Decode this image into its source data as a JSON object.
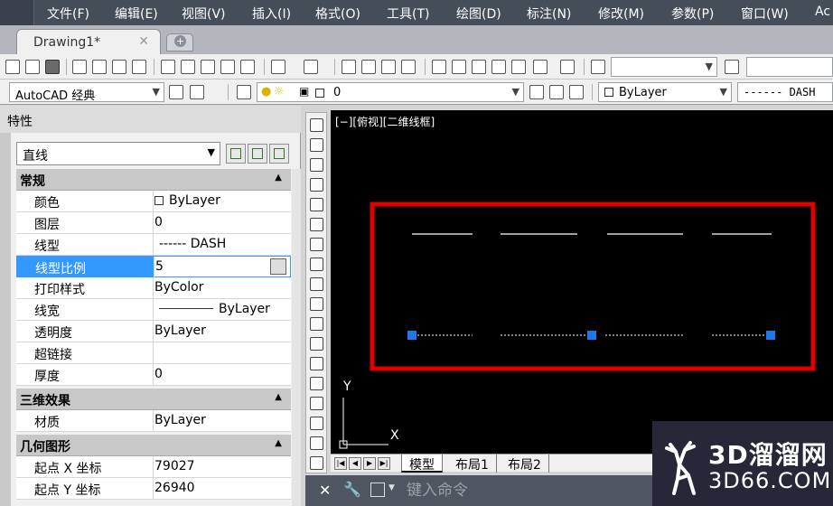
{
  "menu": [
    "文件(F)",
    "编辑(E)",
    "视图(V)",
    "插入(I)",
    "格式(O)",
    "工具(T)",
    "绘图(D)",
    "标注(N)",
    "修改(M)",
    "参数(P)",
    "窗口(W)",
    "Ac"
  ],
  "tab": {
    "title": "Drawing1*",
    "close": "✕",
    "new": "+"
  },
  "toolbar2": {
    "workspace": "AutoCAD 经典",
    "layer": "0",
    "color": "ByLayer",
    "linetype": "------ DASH"
  },
  "properties": {
    "title": "特性",
    "object_type": "直线",
    "sections": [
      {
        "title": "常规",
        "rows": [
          {
            "key": "颜色",
            "value": "ByLayer"
          },
          {
            "key": "图层",
            "value": "0"
          },
          {
            "key": "线型",
            "value": "------ DASH"
          },
          {
            "key": "线型比例",
            "value": "5"
          },
          {
            "key": "打印样式",
            "value": "ByColor"
          },
          {
            "key": "线宽",
            "value": "ByLayer"
          },
          {
            "key": "透明度",
            "value": "ByLayer"
          },
          {
            "key": "超链接",
            "value": ""
          },
          {
            "key": "厚度",
            "value": "0"
          }
        ]
      },
      {
        "title": "三维效果",
        "rows": [
          {
            "key": "材质",
            "value": "ByLayer"
          }
        ]
      },
      {
        "title": "几何图形",
        "rows": [
          {
            "key": "起点 X 坐标",
            "value": "79027"
          },
          {
            "key": "起点 Y 坐标",
            "value": "26940"
          }
        ]
      }
    ]
  },
  "canvas": {
    "view_label": "[−][俯视][二维线框]",
    "axis_y": "Y",
    "axis_x": "X",
    "highlight_color": "#e00000",
    "grip_color": "#1e78e6"
  },
  "layout_tabs": [
    "模型",
    "布局1",
    "布局2"
  ],
  "command": {
    "placeholder": "键入命令",
    "close": "✕",
    "wrench": "🔧"
  },
  "watermark": {
    "title": "3D溜溜网",
    "url": "3D66.COM"
  }
}
